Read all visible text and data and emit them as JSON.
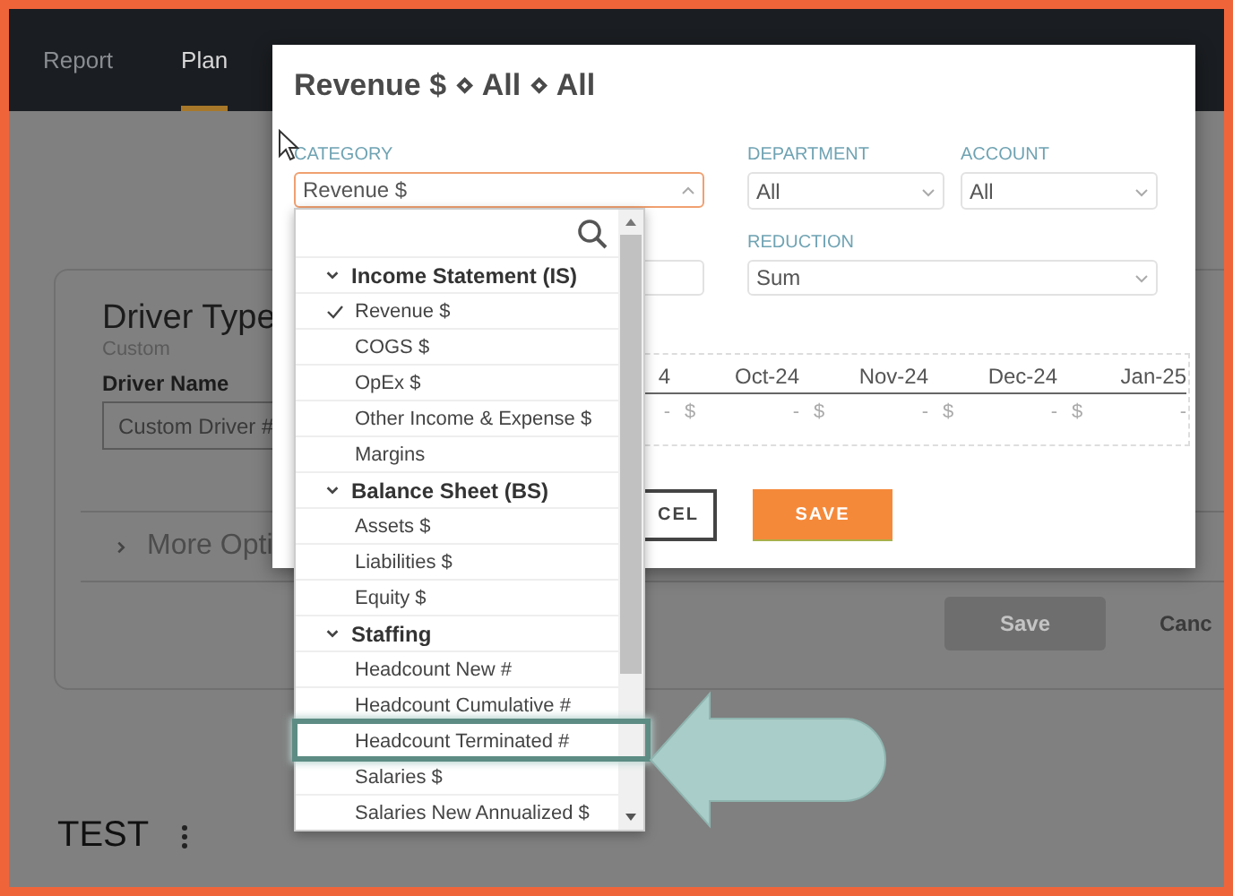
{
  "nav": {
    "tabs": [
      {
        "label": "Report",
        "selected": false
      },
      {
        "label": "Plan",
        "selected": true
      }
    ]
  },
  "page": {
    "card": {
      "title": "Driver Type",
      "subtitle": "Custom",
      "field_label": "Driver Name",
      "field_value": "Custom Driver #",
      "more_options": "More Opti",
      "save_button": {
        "label": "Save",
        "disabled": true
      },
      "cancel_link": "Canc"
    },
    "section_title": "TEST"
  },
  "modal": {
    "title": "Revenue $ ⋄ All ⋄ All",
    "row1": [
      {
        "label": "CATEGORY",
        "value": "Revenue $",
        "focused": true
      },
      {
        "label": "DEPARTMENT",
        "value": "All",
        "focused": false
      },
      {
        "label": "ACCOUNT",
        "value": "All",
        "focused": false
      }
    ],
    "reduction": {
      "label": "REDUCTION",
      "value": "Sum"
    },
    "table": {
      "columns": [
        {
          "header": "4",
          "value": "-"
        },
        {
          "header": "Oct-24",
          "currency": "$",
          "value": "-"
        },
        {
          "header": "Nov-24",
          "currency": "$",
          "value": "-"
        },
        {
          "header": "Dec-24",
          "currency": "$",
          "value": "-"
        },
        {
          "header": "Jan-25",
          "currency": "$",
          "value": "-"
        }
      ]
    },
    "buttons": [
      {
        "kind": "cancel",
        "label": "CEL"
      },
      {
        "kind": "save",
        "label": "SAVE"
      }
    ]
  },
  "dropdown": {
    "groups": [
      {
        "label": "Income Statement (IS)",
        "expanded": true,
        "children": [
          {
            "label": "Revenue $",
            "checked": true,
            "highlighted": false
          },
          {
            "label": "COGS $",
            "checked": false,
            "highlighted": false
          },
          {
            "label": "OpEx $",
            "checked": false,
            "highlighted": false
          },
          {
            "label": "Other Income & Expense $",
            "checked": false,
            "highlighted": false
          },
          {
            "label": "Margins",
            "checked": false,
            "highlighted": false
          }
        ]
      },
      {
        "label": "Balance Sheet (BS)",
        "expanded": true,
        "children": [
          {
            "label": "Assets $",
            "checked": false,
            "highlighted": false
          },
          {
            "label": "Liabilities $",
            "checked": false,
            "highlighted": false
          },
          {
            "label": "Equity $",
            "checked": false,
            "highlighted": false
          }
        ]
      },
      {
        "label": "Staffing",
        "expanded": true,
        "children": [
          {
            "label": "Headcount New #",
            "checked": false,
            "highlighted": false
          },
          {
            "label": "Headcount Cumulative #",
            "checked": false,
            "highlighted": false
          },
          {
            "label": "Headcount Terminated #",
            "checked": false,
            "highlighted": true
          },
          {
            "label": "Salaries $",
            "checked": false,
            "highlighted": false
          },
          {
            "label": "Salaries New Annualized $",
            "checked": false,
            "highlighted": false
          }
        ]
      }
    ]
  }
}
